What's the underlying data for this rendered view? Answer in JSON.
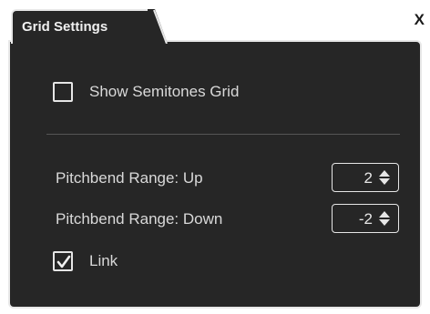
{
  "window": {
    "tab_title": "Grid Settings",
    "close_label": "X"
  },
  "settings": {
    "show_semitones_label": "Show Semitones Grid",
    "show_semitones_checked": false,
    "pitchbend_up_label": "Pitchbend Range: Up",
    "pitchbend_up_value": "2",
    "pitchbend_down_label": "Pitchbend Range: Down",
    "pitchbend_down_value": "-2",
    "link_label": "Link",
    "link_checked": true
  },
  "icons": {
    "check": "check-icon",
    "spin": "up-down-arrows-icon"
  },
  "colors": {
    "panel_bg": "#262626",
    "border": "#e8e8e8",
    "text": "#d9d9d9"
  }
}
